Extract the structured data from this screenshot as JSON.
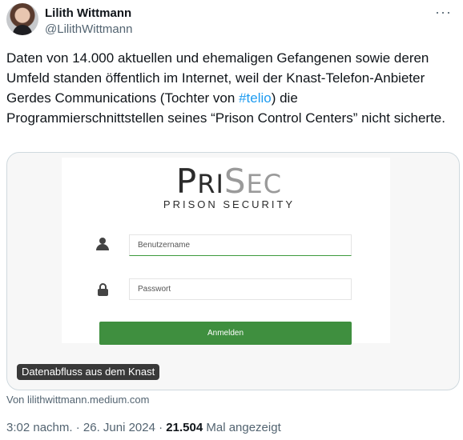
{
  "author": {
    "name": "Lilith Wittmann",
    "handle": "@LilithWittmann",
    "more_icon": "more-dots-icon"
  },
  "tweet": {
    "text_before_hashtag": "Daten von 14.000 aktuellen und ehemaligen Gefangenen sowie deren Umfeld standen öffentlich im Internet, weil der Knast-Telefon-Anbieter Gerdes Communications (Tochter von ",
    "hashtag": "#telio",
    "text_after_hashtag": ") die Programmierschnittstellen seines “Prison Control Centers” nicht sicherte.",
    "hashtag_color": "#1d9bf0"
  },
  "card": {
    "logo": {
      "pri_first": "P",
      "pri_rest": "RI",
      "sec_first": "S",
      "sec_rest": "EC",
      "tagline": "PRISON SECURITY"
    },
    "login": {
      "username_placeholder": "Benutzername",
      "password_placeholder": "Passwort",
      "submit_label": "Anmelden",
      "accent_color": "#3f8f3f"
    },
    "caption": "Datenabfluss aus dem Knast"
  },
  "source": "Von lilithwittmann.medium.com",
  "meta": {
    "timestamp": "3:02 nachm. · 26. Juni 2024 · ",
    "views_count": "21.504",
    "views_label": " Mal angezeigt"
  }
}
